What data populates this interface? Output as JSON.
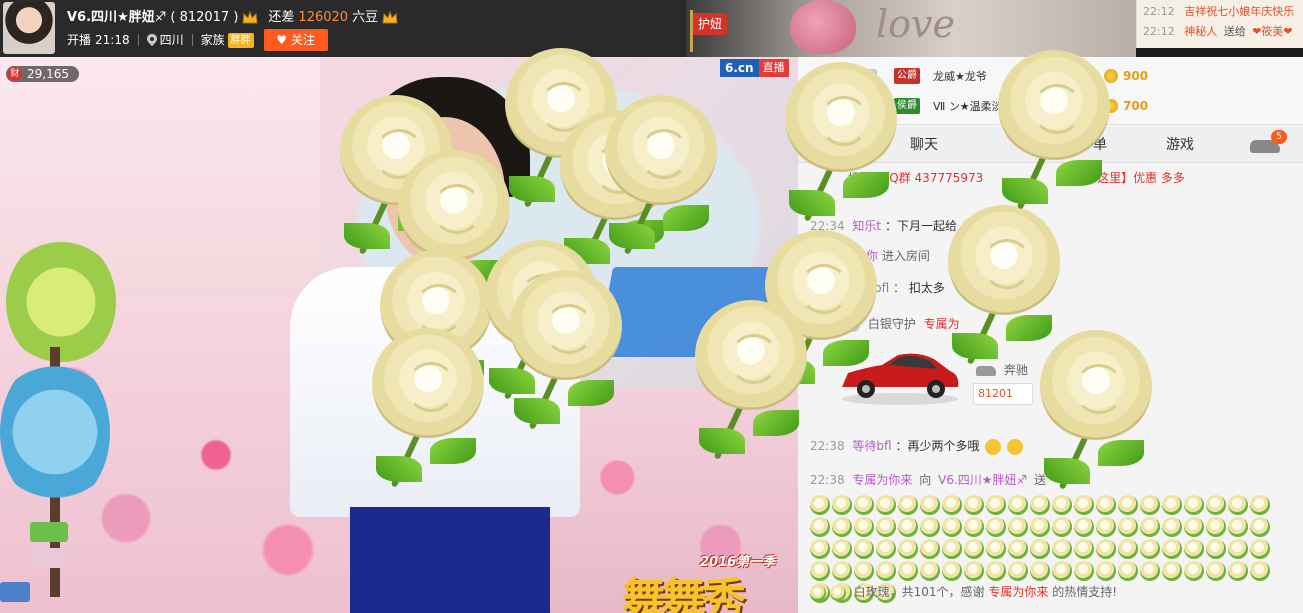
{
  "anchor": {
    "name": "V6.四川★胖妞♐",
    "room_id": "( 812017 )",
    "gap_label": "还差",
    "gap_value": "126020",
    "gap_unit": "六豆",
    "start_label": "开播",
    "start_time": "21:18",
    "location": "四川",
    "family_label": "家族",
    "family_badge": "胖胖",
    "follow_label": "关注"
  },
  "banner": {
    "flag_label": "护妞",
    "love_text": "love"
  },
  "ticker": [
    {
      "time": "22:12",
      "text": "吉祥祝七小娘年庆快乐"
    },
    {
      "time": "22:12",
      "who": "神秘人",
      "verb": "送给",
      "target": "❤筱美❤"
    }
  ],
  "video": {
    "wealth_label": "财",
    "wealth_value": "29,165",
    "logo_site": "6.cn",
    "logo_live": "直播",
    "watermark_year": "2016第一季",
    "watermark_big": "舞舞秀"
  },
  "rank": [
    {
      "num": "1",
      "badge": "公爵",
      "badge_color": "#c2312a",
      "name": "龙威★龙爷",
      "value": "900"
    },
    {
      "num": "",
      "badge": "侯爵",
      "badge_color": "#2e8b2e",
      "name": "Ⅶ ン★温柔淡",
      "value": "700"
    }
  ],
  "tabs": [
    "聊天",
    "单",
    "游戏"
  ],
  "tab_badge": "5",
  "chat": {
    "notice_prefix": "场】",
    "notice_qq": "QQ群 437775973",
    "notice_tail": "这里】优惠 多多",
    "l1_time": "22:34",
    "l1_user": "知乐t",
    "l1_text": "：下月一起给",
    "l2_user": "哥爱你",
    "l2_text": "进入房间",
    "l3_user": "bfl",
    "l3_text": "扣太多",
    "l4_text": "白银守护",
    "l4_user": "专属为",
    "car_brand": "奔驰",
    "greet_box": "81201",
    "l5_time": "22:38",
    "l5_user": "等待bfl",
    "l5_text": "：再少两个多哦",
    "l6_time": "22:38",
    "l6_user": "专属为你来",
    "l6_verb": "向",
    "l6_target": "V6.四川★胖妞♐",
    "l6_send": "送",
    "l7_text_a": "白玫瑰，共101个，感谢",
    "l7_user": "专属为你来",
    "l7_text_b": "的热情支持!"
  },
  "colors": {
    "accent": "#ff5a1f",
    "username": "#b35ec4",
    "alert": "#e0322b",
    "gold": "#e79c16"
  }
}
